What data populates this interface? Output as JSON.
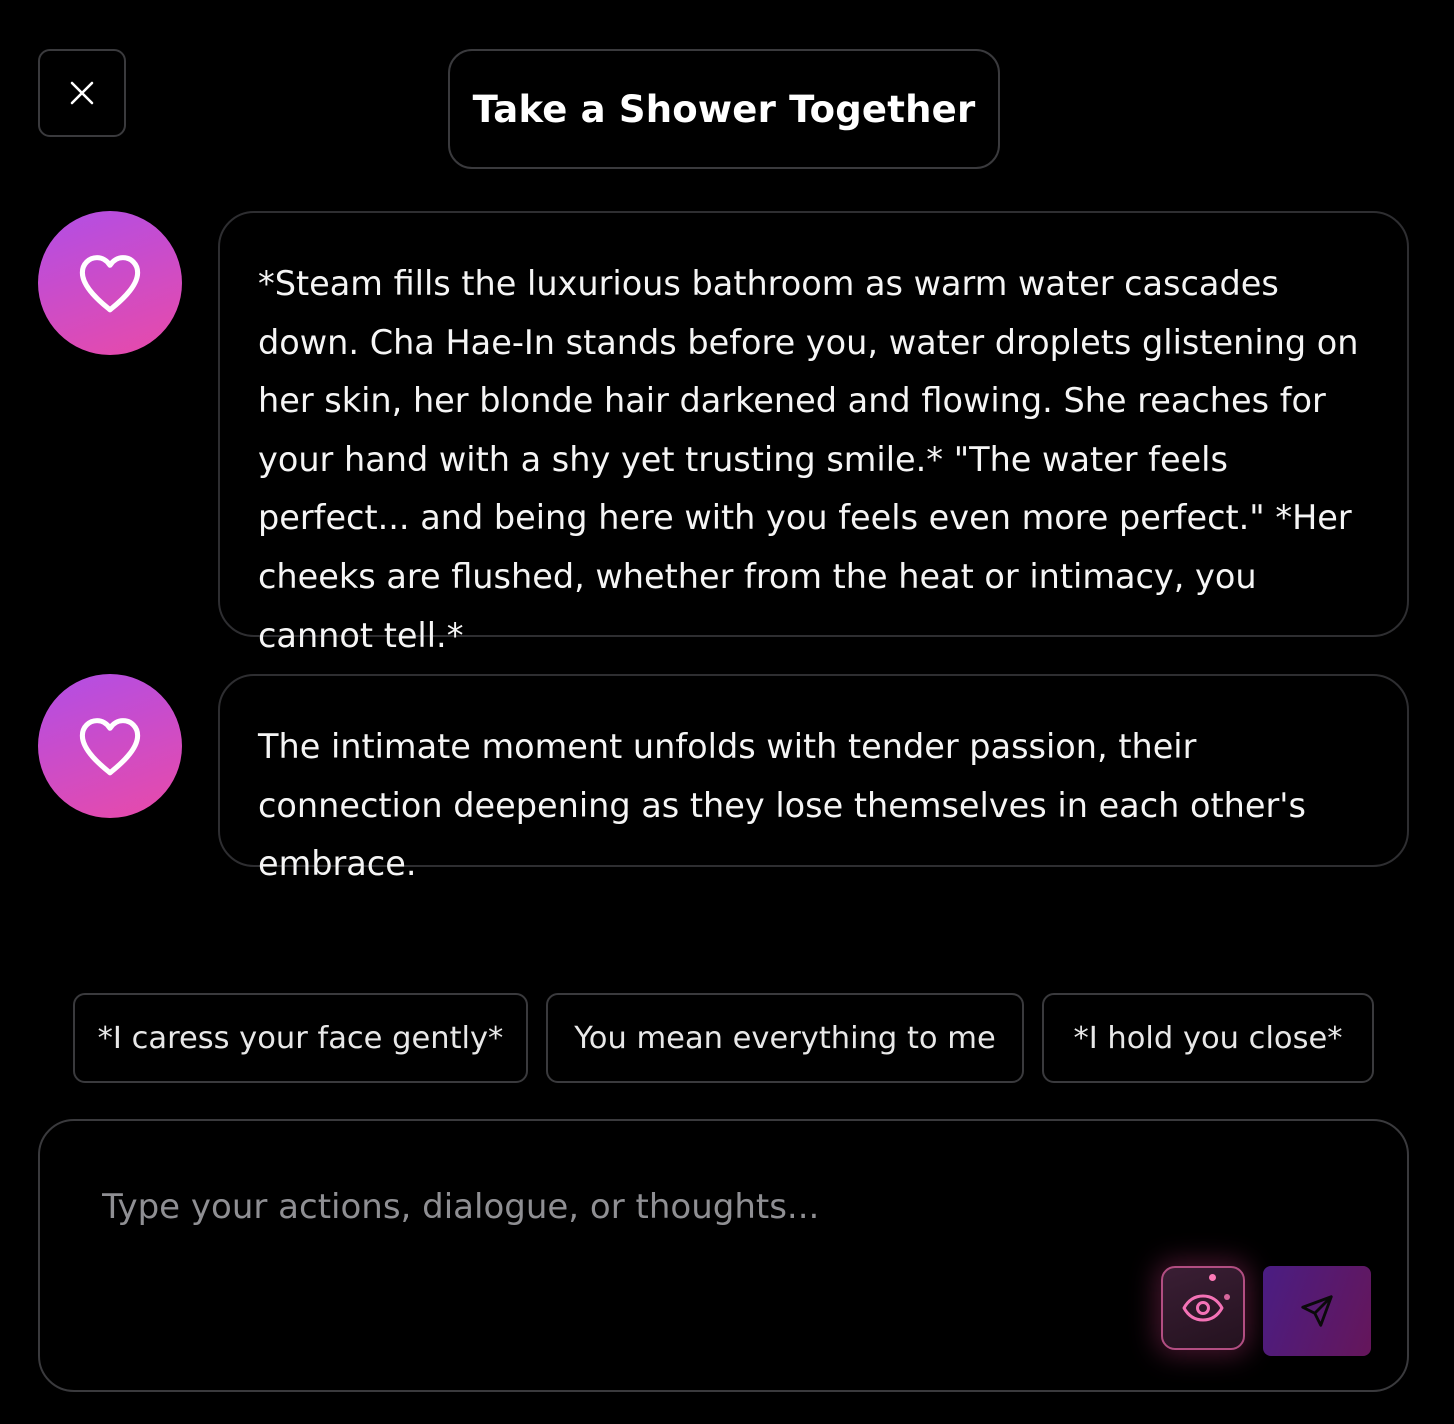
{
  "header": {
    "close_icon": "close-icon",
    "title": "Take a Shower Together"
  },
  "messages": [
    {
      "avatar_icon": "heart-icon",
      "text": "*Steam fills the luxurious bathroom as warm water cascades down. Cha Hae-In stands before you, water droplets glistening on her skin, her blonde hair darkened and flowing. She reaches for your hand with a shy yet trusting smile.* \"The water feels perfect... and being here with you feels even more perfect.\" *Her cheeks are flushed, whether from the heat or intimacy, you cannot tell.*"
    },
    {
      "avatar_icon": "heart-icon",
      "text": "The intimate moment unfolds with tender passion, their connection deepening as they lose themselves in each other's embrace."
    }
  ],
  "quick_replies": [
    "*I caress your face gently*",
    "You mean everything to me",
    "*I hold you close*"
  ],
  "composer": {
    "value": "",
    "placeholder": "Type your actions, dialogue, or thoughts...",
    "eye_icon": "eye-icon",
    "send_icon": "send-icon"
  },
  "colors": {
    "background": "#000000",
    "border": "#3a3a3d",
    "avatar_gradient_start": "#b14ee6",
    "avatar_gradient_end": "#e94aa8",
    "eye_accent": "#ec4899",
    "send_gradient_start": "#4a1d83",
    "send_gradient_end": "#65165a"
  }
}
